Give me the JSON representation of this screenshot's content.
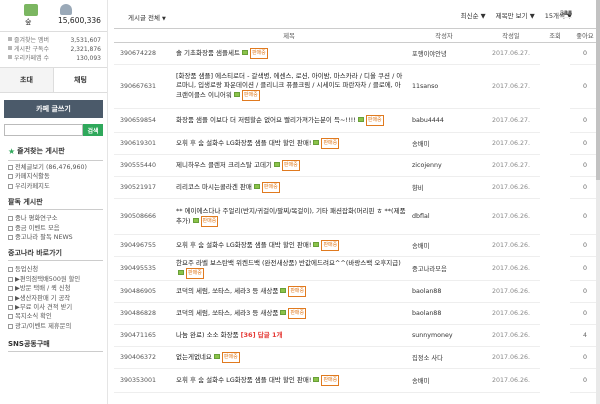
{
  "sidebar": {
    "rank_label": "숲",
    "member_count": "15,600,336",
    "stats": [
      {
        "label": "즐겨찾는 멤버",
        "value": "3,531,607"
      },
      {
        "label": "게시판 구독수",
        "value": "2,321,876"
      },
      {
        "label": "우리카페앱 수",
        "value": "130,093"
      }
    ],
    "tabs": [
      "초대",
      "채팅"
    ],
    "write_label": "카페 글쓰기",
    "search_button": "검색",
    "fav_title": "즐겨찾는 게시판",
    "fav_items": [
      "전체글보기 (86,476,960)",
      "카페지식활동",
      "우리카페지도"
    ],
    "popular_title": "팔독 게시판",
    "popular_items": [
      "중나 평화연구소",
      "중금 이벤트 모음",
      "중고나라 팔독 NEWS"
    ],
    "guide_title": "중고나라 바로가기",
    "guide_items": [
      "등업신청",
      "▶편의점택배500원 할인",
      "▶방문 택배 / 퀵 신청",
      "▶생산자판매 기 공작",
      "▶무료 이사 견적 받기",
      "목지소식 확인",
      "광고/이벤트 제휴문의"
    ],
    "bottom_title": "SNS공동구매"
  },
  "toolbar": {
    "board_select": "게시글 전체",
    "sort": "최신순",
    "view_mode": "제목만 보기",
    "per_page": "15개씩"
  },
  "table": {
    "headers": [
      "제목",
      "작성자",
      "작성일",
      "조회",
      "좋아요"
    ],
    "rows": [
      {
        "num": "390674228",
        "title": "솔 기초화장품 샘플세트",
        "sub": "",
        "badge": "판매중",
        "author": "포행이야안녕",
        "date": "2017.06.27.",
        "views": "20",
        "likes": "0"
      },
      {
        "num": "390667631",
        "title": "[화장품 샘플] 에스티로더 - 갈색병, 에센스, 로션, 아이밤, 마스카라 / 디올 쿠션 / 아르마니, 입생로랑 파운데이션 / 클리니크 퓨플크림 / 시세이도 파란자차 / 클로에, 아크랜이클스 이니어워",
        "sub": "",
        "badge": "판매중",
        "author": "11sanso",
        "date": "2017.06.27.",
        "views": "36",
        "likes": "0"
      },
      {
        "num": "390659854",
        "title": "화장품 샘플 이보다 더 저렴할순 없어요 빨리가져가는분이 득~!!!!",
        "sub": "",
        "badge": "판매중",
        "author": "babu4444",
        "date": "2017.06.27.",
        "views": "34",
        "likes": "0"
      },
      {
        "num": "390619301",
        "title": "오휘 후 숨 설화수 LG화장품 샘플 대박 할인 판매!",
        "sub": "",
        "badge": "판매중",
        "author": "송배미",
        "date": "2017.06.27.",
        "views": "36",
        "likes": "0"
      },
      {
        "num": "390555440",
        "title": "제니하우스 클렌저 크리스탈 고데기",
        "sub": "",
        "badge": "판매중",
        "author": "zicojenny",
        "date": "2017.06.27.",
        "views": "6",
        "likes": "0"
      },
      {
        "num": "390521917",
        "title": "리리코스 마시는콜라겐 판매",
        "sub": "",
        "badge": "판매중",
        "author": "향비",
        "date": "2017.06.26.",
        "views": "11",
        "likes": "0"
      },
      {
        "num": "390508666",
        "title": "** 에이에스다나 주얼리(반지/귀걸이/팔찌/목걸이), 기타 패션잡화(머리핀 ㅎ **(제품추가)",
        "sub": "",
        "badge": "판매중",
        "author": "dbflal",
        "date": "2017.06.26.",
        "views": "14",
        "likes": "0"
      },
      {
        "num": "390496755",
        "title": "오휘 후 숨 설화수 LG화장품 샘플 대박 할인 판매!",
        "sub": "",
        "badge": "판매중",
        "author": "송배미",
        "date": "2017.06.26.",
        "views": "34",
        "likes": "0"
      },
      {
        "num": "390495535",
        "title": "한요주 라벨 보스탄백 위켄드백 (완전새상품) 반값에드려요^^(바랑스백 오후지급)",
        "sub": "",
        "badge": "판매중",
        "author": "중고나라모음",
        "date": "2017.06.26.",
        "views": "23",
        "likes": "0"
      },
      {
        "num": "390486905",
        "title": "코덕의 세럼, 쏘타스, 세라3 등 새상품",
        "sub": "",
        "badge": "판매중",
        "author": "baolan88",
        "date": "2017.06.26.",
        "views": "33",
        "likes": "0"
      },
      {
        "num": "390486828",
        "title": "코덕의 세럼, 쏘타스, 세라3 등 새상품",
        "sub": "",
        "badge": "판매중",
        "author": "baolan88",
        "date": "2017.06.26.",
        "views": "25",
        "likes": "0"
      },
      {
        "num": "390471165",
        "title": "나눔 완료) 소소 화장품",
        "sub": "[36] 답글 1개",
        "badge": "",
        "author": "sunnymoney",
        "date": "2017.06.26.",
        "views": "306",
        "likes": "4"
      },
      {
        "num": "390406372",
        "title": "없는게없네요",
        "sub": "",
        "badge": "판매중",
        "author": "집정소 사다",
        "date": "2017.06.26.",
        "views": "547",
        "likes": "0"
      },
      {
        "num": "390353001",
        "title": "오휘 후 숨 설화수 LG화장품 샘플 대박 할인 판매!",
        "sub": "",
        "badge": "판매중",
        "author": "송배미",
        "date": "2017.06.26.",
        "views": "36",
        "likes": "0"
      }
    ]
  }
}
